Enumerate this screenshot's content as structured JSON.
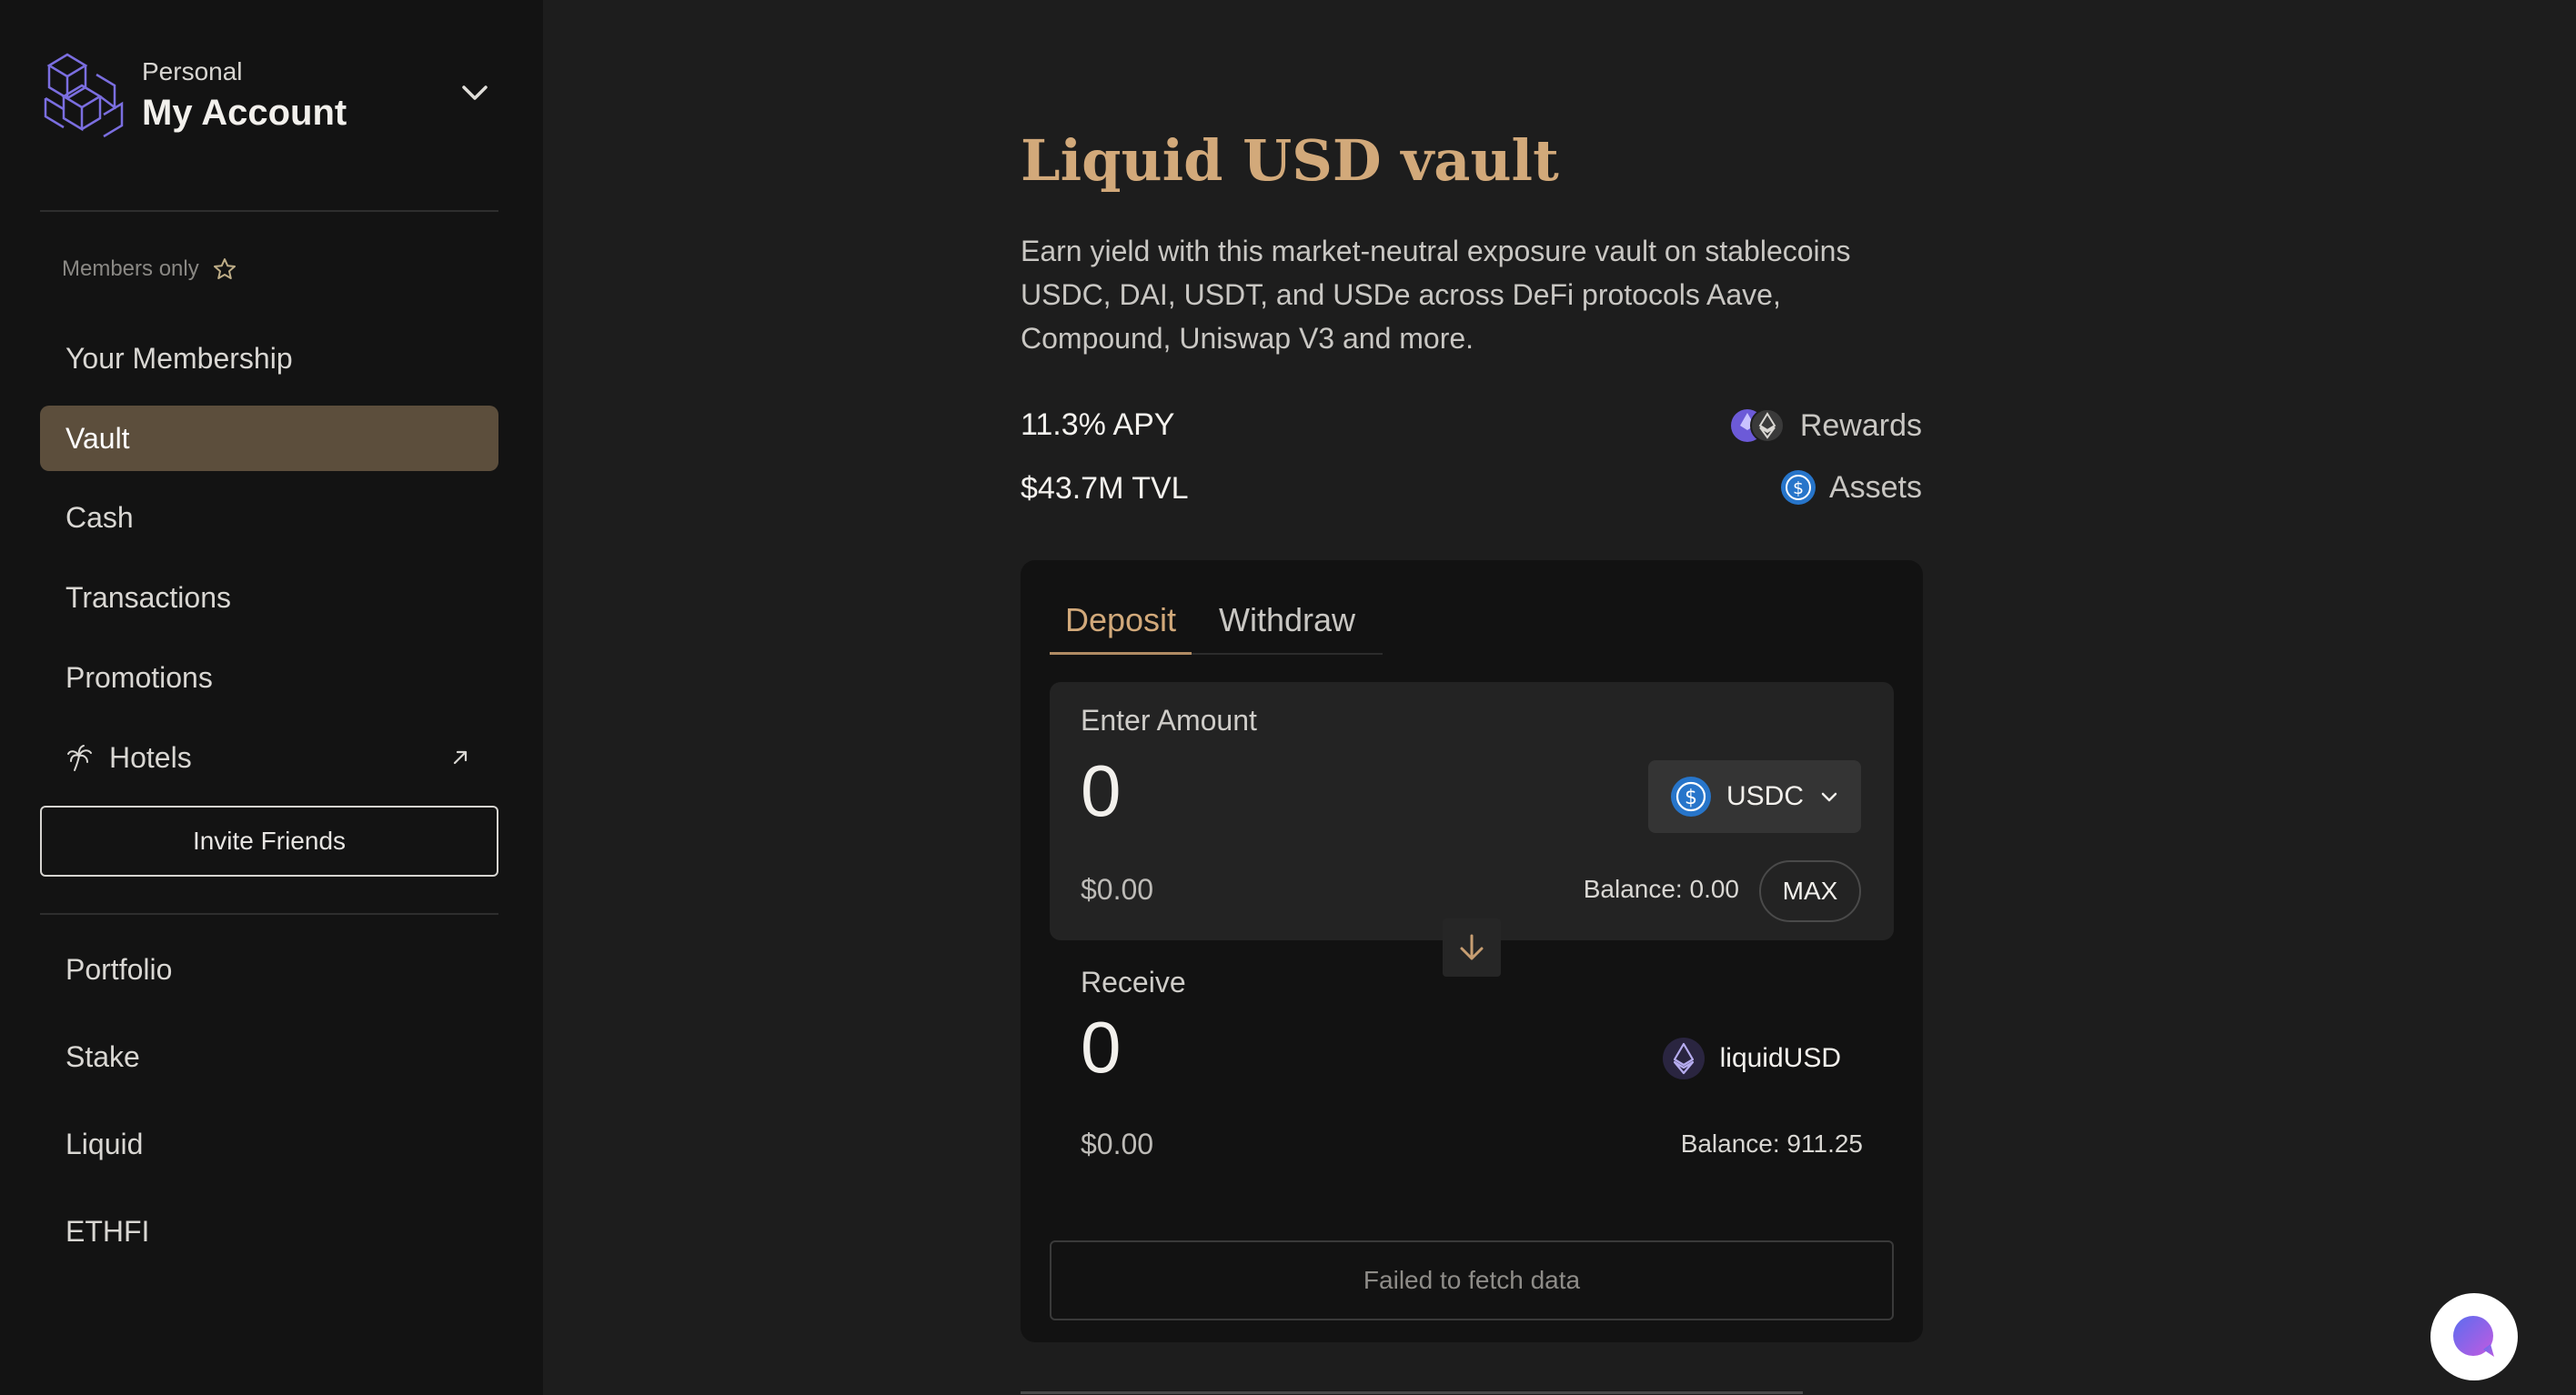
{
  "sidebar": {
    "account": {
      "label": "Personal",
      "name": "My Account"
    },
    "members_label": "Members only",
    "items": [
      {
        "label": "Your Membership",
        "active": false
      },
      {
        "label": "Vault",
        "active": true
      },
      {
        "label": "Cash",
        "active": false
      },
      {
        "label": "Transactions",
        "active": false
      },
      {
        "label": "Promotions",
        "active": false
      },
      {
        "label": "Hotels",
        "active": false,
        "external": true
      }
    ],
    "invite_label": "Invite Friends",
    "secondary_items": [
      {
        "label": "Portfolio"
      },
      {
        "label": "Stake"
      },
      {
        "label": "Liquid"
      },
      {
        "label": "ETHFI"
      }
    ]
  },
  "vault": {
    "title": "Liquid USD vault",
    "description": "Earn yield with this market-neutral exposure vault on stablecoins USDC, DAI, USDT, and USDe across DeFi protocols Aave, Compound, Uniswap V3 and more.",
    "apy": "11.3% APY",
    "tvl": "$43.7M TVL",
    "rewards_label": "Rewards",
    "assets_label": "Assets"
  },
  "form": {
    "tabs": {
      "deposit": "Deposit",
      "withdraw": "Withdraw"
    },
    "enter": {
      "label": "Enter Amount",
      "amount": "0",
      "usd": "$0.00",
      "token": "USDC",
      "balance": "Balance: 0.00",
      "max_label": "MAX"
    },
    "receive": {
      "label": "Receive",
      "amount": "0",
      "usd": "$0.00",
      "token": "liquidUSD",
      "balance": "Balance: 911.25"
    },
    "status_button": "Failed to fetch data"
  },
  "colors": {
    "accent": "#d2a97a",
    "active_nav": "#5c4e3c",
    "usdc_blue": "#2775ca",
    "background": "#1d1d1d",
    "sidebar": "#131313"
  },
  "icons": {
    "logo": "ether-fi-logo-icon",
    "account_toggle": "chevron-down-icon",
    "members": "star-icon",
    "hotels": "palm-tree-icon",
    "external": "arrow-up-right-icon",
    "swap": "arrow-down-icon",
    "chat": "chat-bubble-icon"
  }
}
